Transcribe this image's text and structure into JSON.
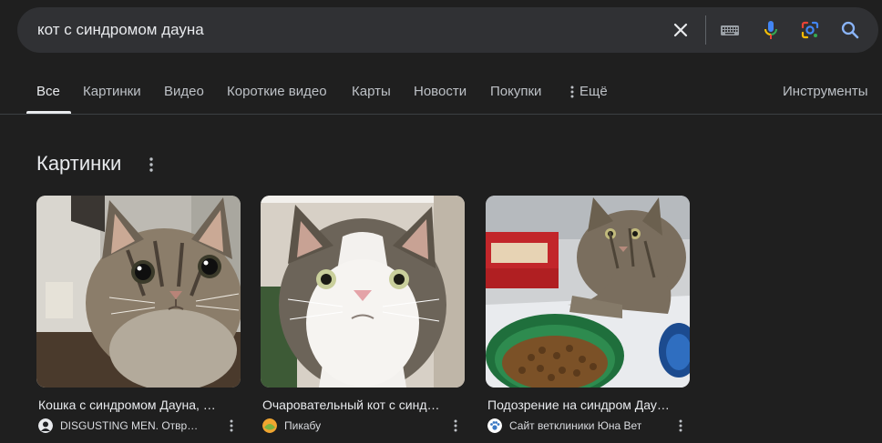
{
  "search": {
    "query": "кот с синдромом дауна",
    "icons": [
      "close-icon",
      "keyboard-icon",
      "mic-icon",
      "lens-icon",
      "search-icon"
    ]
  },
  "tabs": [
    {
      "label": "Все",
      "active": true
    },
    {
      "label": "Картинки"
    },
    {
      "label": "Видео"
    },
    {
      "label": "Короткие видео"
    },
    {
      "label": "Карты"
    },
    {
      "label": "Новости"
    },
    {
      "label": "Покупки"
    },
    {
      "label": "Ещё"
    },
    {
      "label": "Инструменты"
    }
  ],
  "section": {
    "title": "Картинки"
  },
  "images": [
    {
      "title": "Кошка с синдромом Дауна, …",
      "source": "DISGUSTING MEN. Отвр…"
    },
    {
      "title": "Очаровательный кот с синд…",
      "source": "Пикабу"
    },
    {
      "title": "Подозрение на синдром Дау…",
      "source": "Сайт ветклиники Юна Вет"
    }
  ],
  "colors": {
    "background": "#1f1f1f",
    "searchbar": "#303134",
    "text": "#e8eaed",
    "muted": "#bdc1c6",
    "accent_blue": "#8ab4f8"
  }
}
